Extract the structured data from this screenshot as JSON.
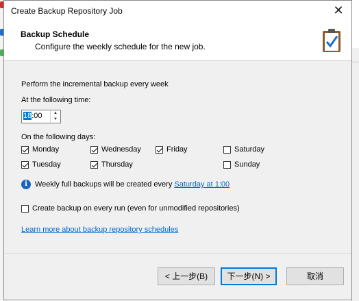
{
  "window": {
    "title": "Create Backup Repository Job"
  },
  "header": {
    "title": "Backup Schedule",
    "subtitle": "Configure the weekly schedule for the new job."
  },
  "schedule": {
    "intro": "Perform the incremental backup every week",
    "time_label": "At the following time:",
    "time_hour": "18",
    "time_rest": ":00",
    "days_label": "On the following days:",
    "days": [
      {
        "label": "Monday",
        "checked": true
      },
      {
        "label": "Wednesday",
        "checked": true
      },
      {
        "label": "Friday",
        "checked": true
      },
      {
        "label": "Saturday",
        "checked": false
      },
      {
        "label": "Tuesday",
        "checked": true
      },
      {
        "label": "Thursday",
        "checked": true
      },
      {
        "label": "Sunday",
        "checked": false
      }
    ],
    "info_text": "Weekly full backups will be created every",
    "info_link": "Saturday at 1:00",
    "create_every_run": {
      "label": "Create backup on every run (even for unmodified repositories)",
      "checked": false
    },
    "learn_more": "Learn more about backup repository schedules"
  },
  "buttons": {
    "back": "< 上一步(B)",
    "next": "下一步(N) >",
    "cancel": "取消"
  }
}
